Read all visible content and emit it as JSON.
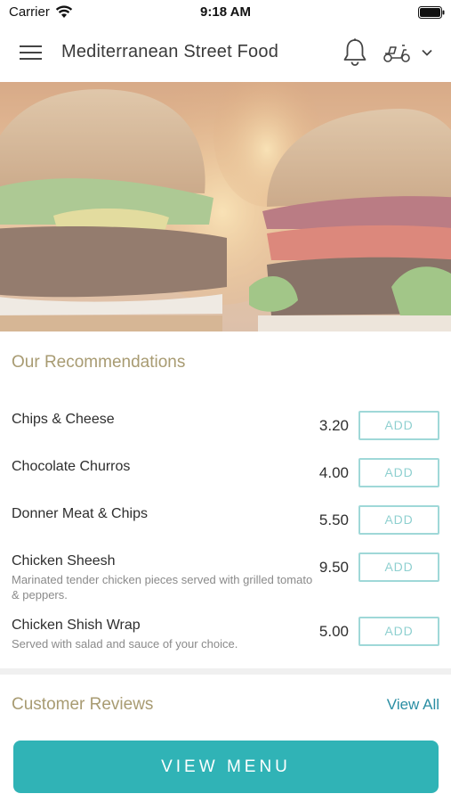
{
  "status_bar": {
    "carrier": "Carrier",
    "time": "9:18 AM"
  },
  "header": {
    "title": "Mediterranean Street Food",
    "icons": [
      "menu-icon",
      "bell-icon",
      "scooter-icon",
      "chevron-down-icon"
    ]
  },
  "recommendations": {
    "title": "Our Recommendations",
    "items": [
      {
        "name": "Chips & Cheese",
        "description": "",
        "price": "3.20",
        "button": "ADD"
      },
      {
        "name": "Chocolate Churros",
        "description": "",
        "price": "4.00",
        "button": "ADD"
      },
      {
        "name": "Donner Meat & Chips",
        "description": "",
        "price": "5.50",
        "button": "ADD"
      },
      {
        "name": "Chicken Sheesh",
        "description": "Marinated tender chicken pieces served with grilled tomato & peppers.",
        "price": "9.50",
        "button": "ADD"
      },
      {
        "name": "Chicken Shish Wrap",
        "description": "Served with salad and sauce of your choice.",
        "price": "5.00",
        "button": "ADD"
      }
    ]
  },
  "reviews": {
    "title": "Customer Reviews",
    "view_all": "View All"
  },
  "cta": {
    "label": "VIEW MENU"
  },
  "colors": {
    "accent": "#30b3b6",
    "section_title": "#a89b72",
    "link": "#2a8ea3",
    "add_border": "#9fd8d8"
  }
}
